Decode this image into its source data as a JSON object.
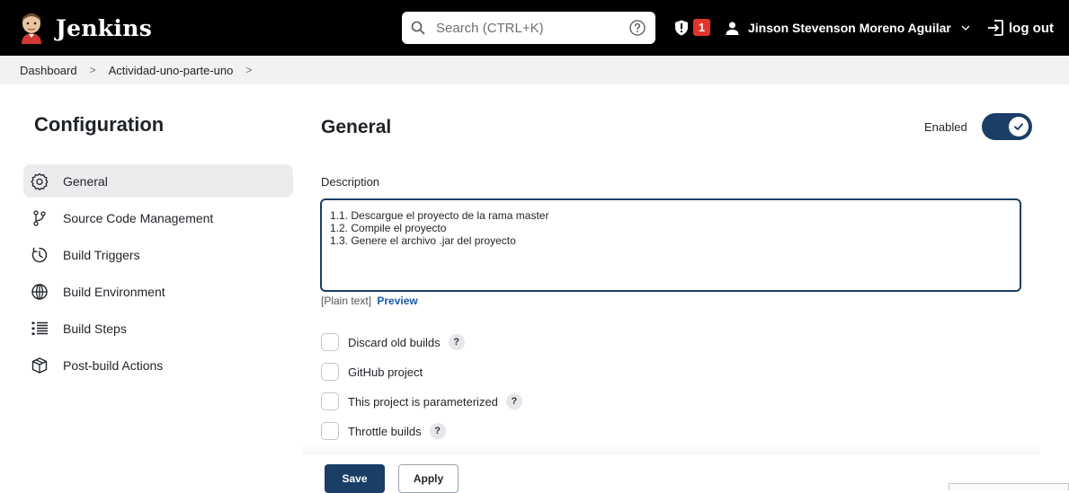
{
  "header": {
    "brand": "Jenkins",
    "search_placeholder": "Search (CTRL+K)",
    "notification_count": "1",
    "user_name": "Jinson Stevenson Moreno Aguilar",
    "logout_label": "log out",
    "colors": {
      "bar": "#000000",
      "badge": "#e0352b"
    }
  },
  "breadcrumb": {
    "items": [
      "Dashboard",
      "Actividad-uno-parte-uno"
    ]
  },
  "sidebar": {
    "title": "Configuration",
    "items": [
      {
        "label": "General",
        "icon": "gear-icon",
        "active": true
      },
      {
        "label": "Source Code Management",
        "icon": "branch-icon",
        "active": false
      },
      {
        "label": "Build Triggers",
        "icon": "timer-icon",
        "active": false
      },
      {
        "label": "Build Environment",
        "icon": "globe-icon",
        "active": false
      },
      {
        "label": "Build Steps",
        "icon": "list-icon",
        "active": false
      },
      {
        "label": "Post-build Actions",
        "icon": "package-icon",
        "active": false
      }
    ]
  },
  "main": {
    "section_title": "General",
    "enabled_label": "Enabled",
    "enabled": true,
    "description_label": "Description",
    "description_value": "1.1. Descargue el proyecto de la rama master\n1.2. Compile el proyecto\n1.3. Genere el archivo .jar del proyecto",
    "plain_text_label": "[Plain text]",
    "preview_label": "Preview",
    "options": [
      {
        "label": "Discard old builds",
        "help": true,
        "checked": false
      },
      {
        "label": "GitHub project",
        "help": false,
        "checked": false
      },
      {
        "label": "This project is parameterized",
        "help": true,
        "checked": false
      },
      {
        "label": "Throttle builds",
        "help": true,
        "checked": false
      }
    ],
    "help_glyph": "?"
  },
  "footer": {
    "save_label": "Save",
    "apply_label": "Apply",
    "colors": {
      "primary": "#1a3e66"
    }
  }
}
